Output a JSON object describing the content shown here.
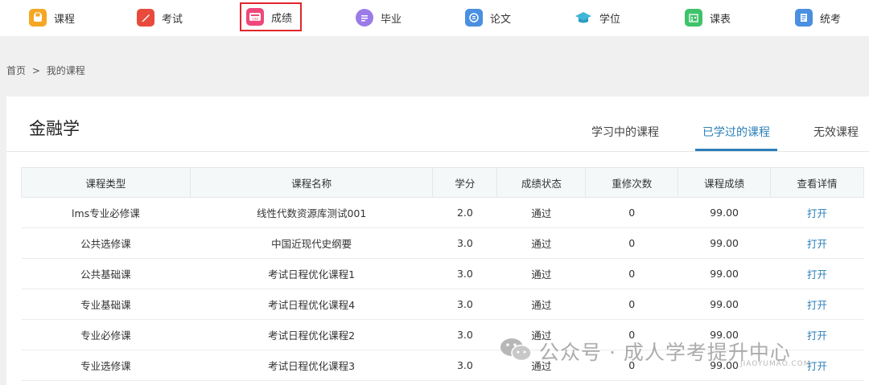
{
  "nav": [
    {
      "label": "课程",
      "icon": "course-icon",
      "color": "#f5a623"
    },
    {
      "label": "考试",
      "icon": "exam-icon",
      "color": "#e84a3c"
    },
    {
      "label": "成绩",
      "icon": "score-icon",
      "color": "#f0477a"
    },
    {
      "label": "毕业",
      "icon": "graduation-icon",
      "color": "#9b7be8"
    },
    {
      "label": "论文",
      "icon": "thesis-icon",
      "color": "#4a8fe0"
    },
    {
      "label": "学位",
      "icon": "degree-cap-icon",
      "color": "#3fb6d8"
    },
    {
      "label": "课表",
      "icon": "calendar-icon",
      "color": "#3fc26b"
    },
    {
      "label": "统考",
      "icon": "unified-exam-icon",
      "color": "#4a8fe0"
    }
  ],
  "breadcrumb": {
    "home": "首页",
    "sep": ">",
    "current": "我的课程"
  },
  "major": "金融学",
  "tabs": [
    {
      "label": "学习中的课程"
    },
    {
      "label": "已学过的课程"
    },
    {
      "label": "无效课程"
    }
  ],
  "table": {
    "headers": [
      "课程类型",
      "课程名称",
      "学分",
      "成绩状态",
      "重修次数",
      "课程成绩",
      "查看详情"
    ],
    "rows": [
      [
        "lms专业必修课",
        "线性代数资源库测试001",
        "2.0",
        "通过",
        "0",
        "99.00",
        "打开"
      ],
      [
        "公共选修课",
        "中国近现代史纲要",
        "3.0",
        "通过",
        "0",
        "99.00",
        "打开"
      ],
      [
        "公共基础课",
        "考试日程优化课程1",
        "3.0",
        "通过",
        "0",
        "99.00",
        "打开"
      ],
      [
        "专业基础课",
        "考试日程优化课程4",
        "3.0",
        "通过",
        "0",
        "99.00",
        "打开"
      ],
      [
        "专业必修课",
        "考试日程优化课程2",
        "3.0",
        "通过",
        "0",
        "99.00",
        "打开"
      ],
      [
        "专业选修课",
        "考试日程优化课程3",
        "3.0",
        "通过",
        "0",
        "99.00",
        "打开"
      ]
    ]
  },
  "watermark": {
    "text": "公众号 · 成人学考提升中心",
    "sub": "JIAOYUMAO.COM"
  },
  "colors": {
    "accent": "#2a7fb8",
    "highlight_box": "#e0262b"
  }
}
